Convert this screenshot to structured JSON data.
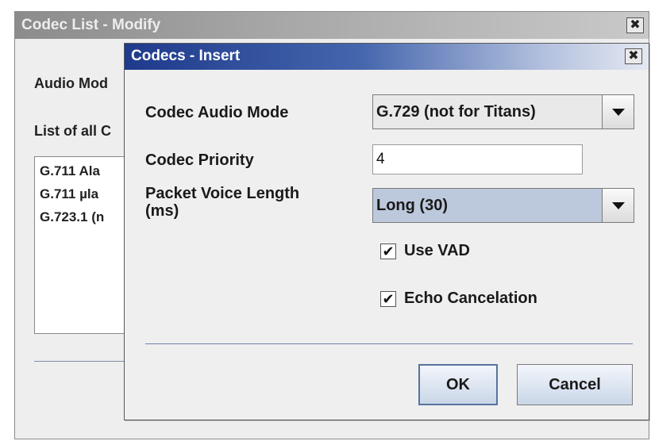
{
  "background_dialog": {
    "title": "Codec List - Modify",
    "close_glyph": "✖",
    "audio_mode_label": "Audio Mod",
    "list_label": "List of all C",
    "list_items": [
      "G.711 Ala",
      "G.711 µla",
      "G.723.1 (n"
    ]
  },
  "dialog": {
    "title": "Codecs - Insert",
    "close_glyph": "✖",
    "fields": {
      "codec_audio_mode": {
        "label": "Codec Audio Mode",
        "value": "G.729 (not for Titans)"
      },
      "codec_priority": {
        "label": "Codec Priority",
        "value": "4"
      },
      "packet_voice_length": {
        "label_line1": "Packet Voice Length",
        "label_line2": "(ms)",
        "value": "Long (30)"
      }
    },
    "checkboxes": {
      "use_vad": {
        "label": "Use VAD",
        "checked": true,
        "glyph": "✔"
      },
      "echo_cancelation": {
        "label": "Echo Cancelation",
        "checked": true,
        "glyph": "✔"
      }
    },
    "buttons": {
      "ok": "OK",
      "cancel": "Cancel"
    }
  },
  "colors": {
    "active_titlebar": "#1e3a8c",
    "selected_combo": "#bcc8dc",
    "button_gradient_end": "#c9d6e8"
  },
  "icons": [
    "close-icon",
    "dropdown-arrow-icon",
    "checkmark-icon"
  ]
}
